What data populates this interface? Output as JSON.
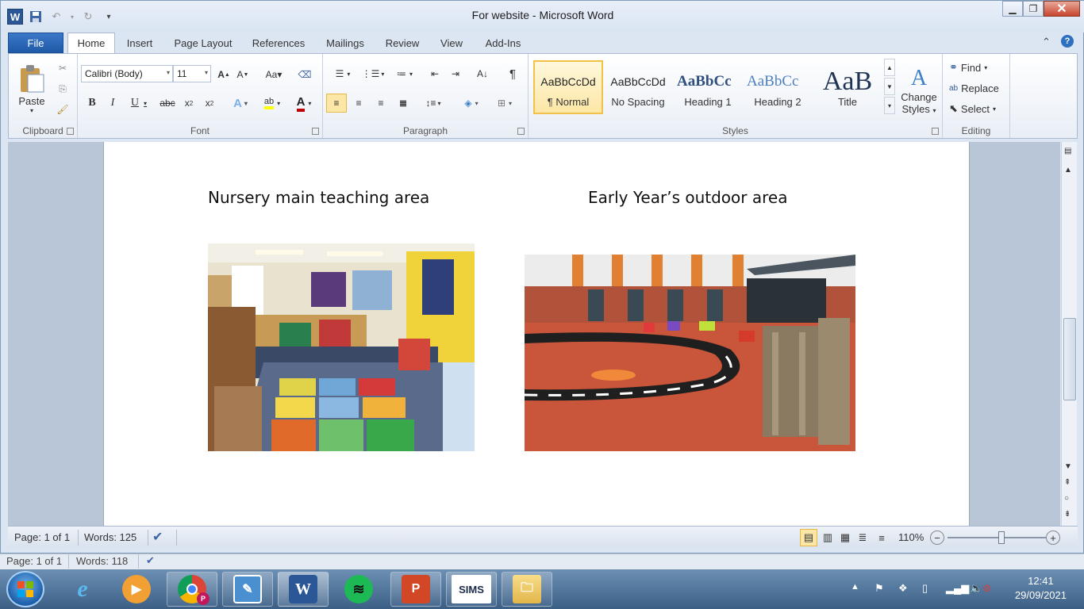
{
  "window": {
    "title": "For website  -  Microsoft Word"
  },
  "qat": {
    "app_icon": "word-icon",
    "save": "save-icon",
    "undo": "undo-icon",
    "redo": "redo-icon",
    "customize": "▾"
  },
  "tabs": [
    "File",
    "Home",
    "Insert",
    "Page Layout",
    "References",
    "Mailings",
    "Review",
    "View",
    "Add-Ins"
  ],
  "ribbon": {
    "clipboard": {
      "label": "Clipboard",
      "paste": "Paste"
    },
    "font": {
      "label": "Font",
      "name": "Calibri (Body)",
      "size": "11"
    },
    "paragraph": {
      "label": "Paragraph"
    },
    "styles": {
      "label": "Styles",
      "items": [
        {
          "preview": "AaBbCcDd",
          "name": "¶ Normal"
        },
        {
          "preview": "AaBbCcDd",
          "name": "No Spacing"
        },
        {
          "preview": "AaBbCc",
          "name": "Heading 1"
        },
        {
          "preview": "AaBbCc",
          "name": "Heading 2"
        },
        {
          "preview": "AaB",
          "name": "Title"
        }
      ],
      "change_line1": "Change",
      "change_line2": "Styles"
    },
    "editing": {
      "label": "Editing",
      "find": "Find",
      "replace": "Replace",
      "select": "Select"
    }
  },
  "document": {
    "caption_left": "Nursery main teaching area",
    "caption_right": "Early Year’s outdoor area"
  },
  "status": {
    "page": "Page: 1 of 1",
    "words": "Words: 125",
    "zoom": "110%",
    "zoom_level": 0.55
  },
  "bg_status": {
    "page": "Page: 1 of 1",
    "words": "Words: 118"
  },
  "taskbar": {
    "sims": "SIMS",
    "time": "12:41",
    "date": "29/09/2021"
  },
  "colors": {
    "file_tab": "#1f5aa8",
    "highlight": "#ffff00",
    "font_color": "#c00000",
    "normal_style_border": "#f2c14a"
  }
}
